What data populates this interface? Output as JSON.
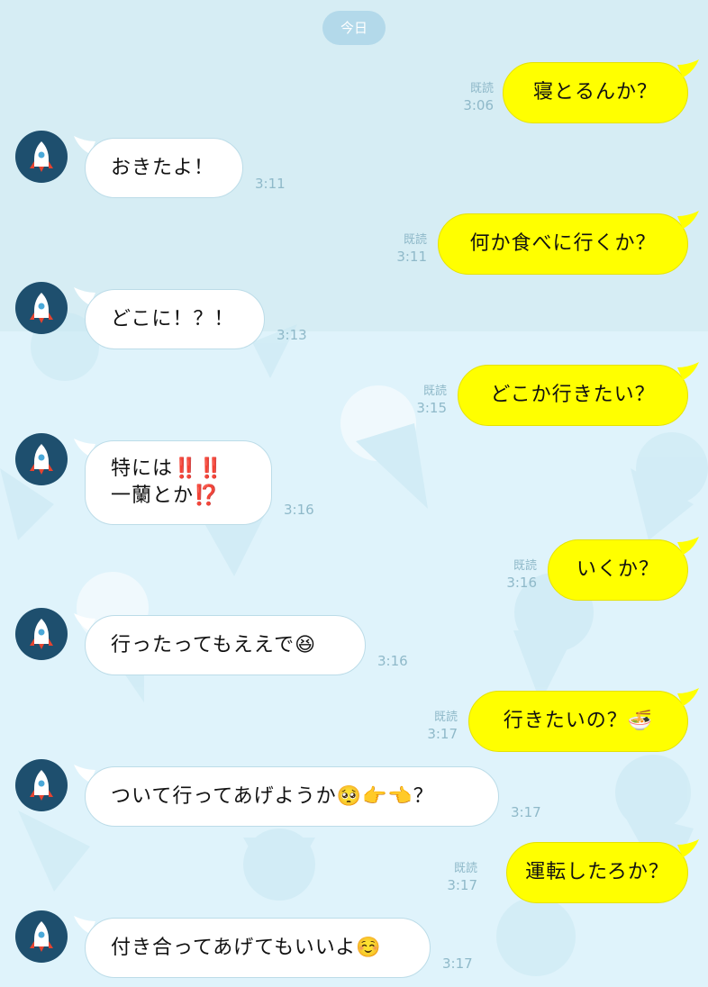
{
  "date_label": "今日",
  "colors": {
    "outgoing_bubble": "#ffff00",
    "incoming_bubble": "#ffffff",
    "background_top": "#d6edf4",
    "background_bottom": "#dff3fb",
    "meta_text": "#8fb9c9",
    "avatar_bg": "#1e4f6e"
  },
  "avatar_icon": "rocket-icon",
  "messages": [
    {
      "side": "out",
      "text": "寝とるんか？",
      "read": "既読",
      "time": "3:06"
    },
    {
      "side": "in",
      "text": "おきたよ！",
      "time": "3:11"
    },
    {
      "side": "out",
      "text": "何か食べに行くか？",
      "read": "既読",
      "time": "3:11"
    },
    {
      "side": "in",
      "text": "どこに！？！",
      "time": "3:13"
    },
    {
      "side": "out",
      "text": "どこか行きたい？",
      "read": "既読",
      "time": "3:15"
    },
    {
      "side": "in",
      "line1": "特には",
      "line1_emoji": "‼️‼️",
      "line2": "一蘭とか",
      "line2_emoji": "⁉️",
      "time": "3:16"
    },
    {
      "side": "out",
      "text": "いくか？",
      "read": "既読",
      "time": "3:16"
    },
    {
      "side": "in",
      "text": "行ったってもええで",
      "emoji": "😆",
      "time": "3:16"
    },
    {
      "side": "out",
      "text": "行きたいの？",
      "emoji": "🍜",
      "read": "既読",
      "time": "3:17"
    },
    {
      "side": "in",
      "text": "ついて行ってあげようか",
      "emoji": "🥺👉👈",
      "text_after": "？",
      "time": "3:17"
    },
    {
      "side": "out",
      "text": "運転したろか？",
      "read": "既読",
      "time": "3:17"
    },
    {
      "side": "in",
      "text": "付き合ってあげてもいいよ",
      "emoji": "☺️",
      "time": "3:17"
    }
  ]
}
